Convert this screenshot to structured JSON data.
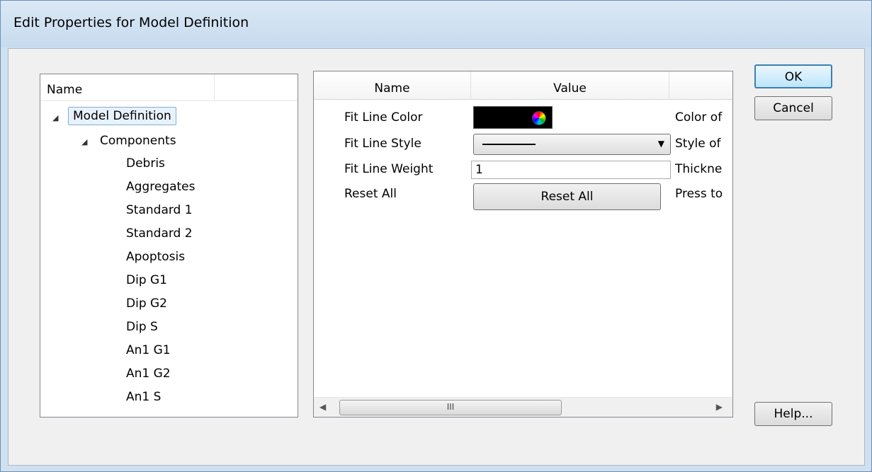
{
  "window": {
    "title": "Edit Properties for Model Definition"
  },
  "tree": {
    "header": "Name",
    "root": "Model Definition",
    "group": "Components",
    "items": [
      "Debris",
      "Aggregates",
      "Standard 1",
      "Standard 2",
      "Apoptosis",
      "Dip G1",
      "Dip G2",
      "Dip S",
      "An1 G1",
      "An1 G2",
      "An1 S"
    ]
  },
  "grid": {
    "columns": {
      "name": "Name",
      "value": "Value"
    },
    "rows": [
      {
        "name": "Fit Line Color",
        "desc": "Color of"
      },
      {
        "name": "Fit Line Style",
        "desc": "Style of"
      },
      {
        "name": "Fit Line Weight",
        "value": "1",
        "desc": "Thickne"
      },
      {
        "name": "Reset All",
        "button": "Reset All",
        "desc": "Press to"
      }
    ],
    "scroll_grip": "III"
  },
  "buttons": {
    "ok": "OK",
    "cancel": "Cancel",
    "help": "Help..."
  },
  "colors": {
    "fit_line_color": "#000000",
    "accent": "#3c7fb1"
  }
}
